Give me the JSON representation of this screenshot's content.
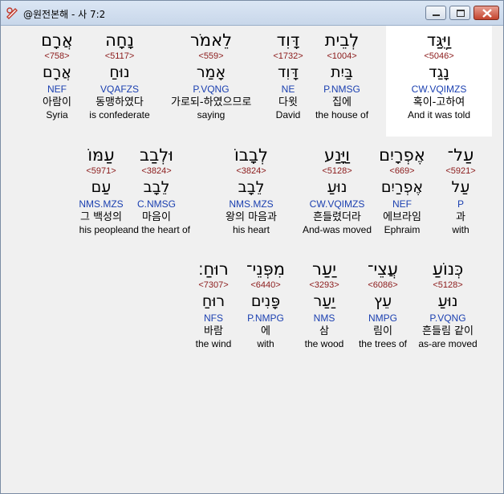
{
  "window": {
    "title": "@원전본해 - 사 7:2"
  },
  "rows": [
    [
      {
        "heb": "וַיֻּגַּד",
        "strong": "<5046>",
        "lemma": "נָגַד",
        "parse": "CW.VQIMZS",
        "kor": "혹이-고하여",
        "eng": "And it was told",
        "highlight": true
      },
      {
        "heb": "לְבֵית",
        "strong": "<1004>",
        "lemma": "בַּיִת",
        "parse": "P.NMSG",
        "kor": "집에",
        "eng": "the house of"
      },
      {
        "heb": "דָּוִד",
        "strong": "<1732>",
        "lemma": "דָּוִד",
        "parse": "NE",
        "kor": "다윗",
        "eng": "David"
      },
      {
        "heb": "לֵאמֹר",
        "strong": "<559>",
        "lemma": "אָמַר",
        "parse": "P.VQNG",
        "kor": "가로되-하였으므로",
        "eng": "saying"
      },
      {
        "heb": "נָחָה",
        "strong": "<5117>",
        "lemma": "נוּחַ",
        "parse": "VQAFZS",
        "kor": "동맹하였다",
        "eng": "is confederate"
      },
      {
        "heb": "אֲרָם",
        "strong": "<758>",
        "lemma": "אֲרָם",
        "parse": "NEF",
        "kor": "아람이",
        "eng": "Syria"
      }
    ],
    [
      {
        "heb": "עַל־",
        "strong": "<5921>",
        "lemma": "עַל",
        "parse": "P",
        "kor": "과",
        "eng": "with"
      },
      {
        "heb": "אֶפְרָיִם",
        "strong": "<669>",
        "lemma": "אֶפְרַיִם",
        "parse": "NEF",
        "kor": "에브라임",
        "eng": "Ephraim"
      },
      {
        "heb": "וַיָּנַע",
        "strong": "<5128>",
        "lemma": "נוּעַ",
        "parse": "CW.VQIMZS",
        "kor": "흔들렸더라",
        "eng": "And-was moved"
      },
      {
        "heb": "לְבָבוֹ",
        "strong": "<3824>",
        "lemma": "לֵבָב",
        "parse": "NMS.MZS",
        "kor": "왕의 마음과",
        "eng": "his heart"
      },
      {
        "heb": "וּלְבַב",
        "strong": "<3824>",
        "lemma": "לֵבָב",
        "parse": "C.NMSG",
        "kor": "마음이",
        "eng": "and the heart of"
      },
      {
        "heb": "עַמּוֹ",
        "strong": "<5971>",
        "lemma": "עַם",
        "parse": "NMS.MZS",
        "kor": "그 백성의",
        "eng": "his people"
      }
    ],
    [
      {
        "heb": "כְּנוֹעַ",
        "strong": "<5128>",
        "lemma": "נוּעַ",
        "parse": "P.VQNG",
        "kor": "흔들림 같이",
        "eng": "as-are moved"
      },
      {
        "heb": "עֲצֵי־",
        "strong": "<6086>",
        "lemma": "עֵץ",
        "parse": "NMPG",
        "kor": "림이",
        "eng": "the trees of"
      },
      {
        "heb": "יַעַר",
        "strong": "<3293>",
        "lemma": "יַעַר",
        "parse": "NMS",
        "kor": "삼",
        "eng": "the wood"
      },
      {
        "heb": "מִפְּנֵי־",
        "strong": "<6440>",
        "lemma": "פָּנִים",
        "parse": "P.NMPG",
        "kor": "에",
        "eng": "with"
      },
      {
        "heb": "רוּחַ׃",
        "strong": "<7307>",
        "lemma": "רוּחַ",
        "parse": "NFS",
        "kor": "바람",
        "eng": "the wind"
      }
    ]
  ]
}
